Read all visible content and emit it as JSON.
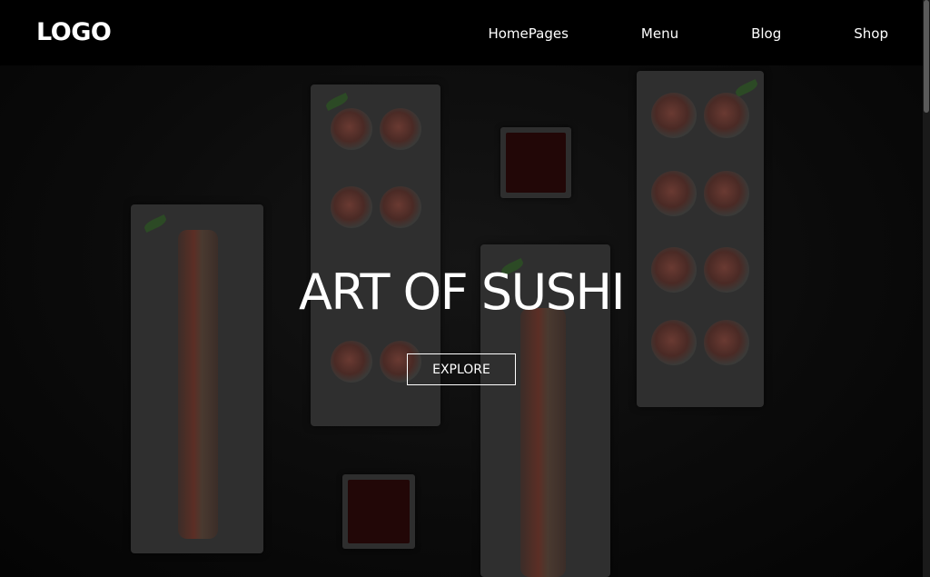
{
  "header": {
    "logo": "LOGO",
    "nav": [
      {
        "label": "HomePages"
      },
      {
        "label": "Menu"
      },
      {
        "label": "Blog"
      },
      {
        "label": "Shop"
      }
    ]
  },
  "hero": {
    "title": "ART OF SUSHI",
    "button_label": "EXPLORE",
    "background": "sushi-plates-photo"
  },
  "colors": {
    "background": "#000000",
    "text": "#ffffff",
    "button_border": "#ffffff"
  }
}
